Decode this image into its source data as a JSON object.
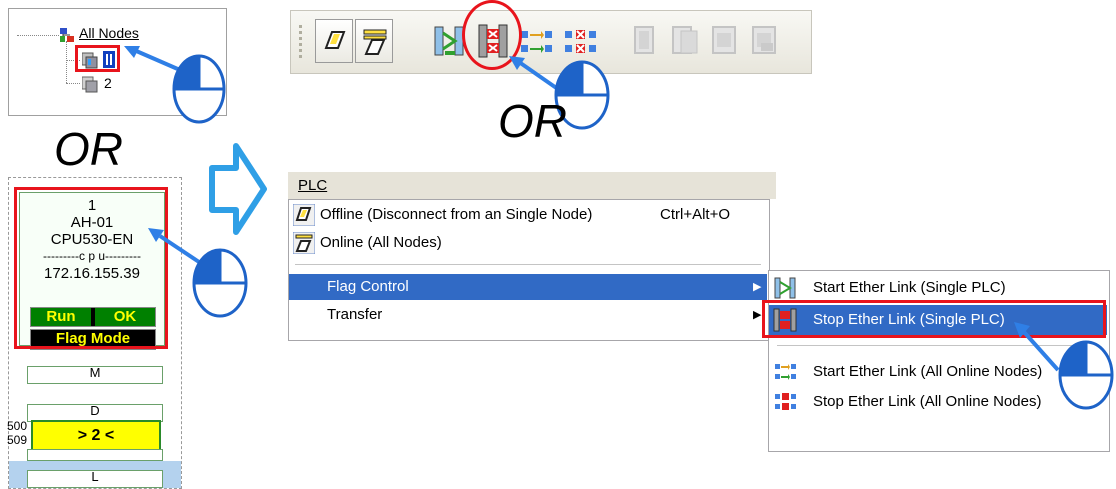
{
  "tree": {
    "root_label": "All Nodes",
    "child2_label": "2"
  },
  "or_labels": {
    "left": "OR",
    "toolbar": "OR"
  },
  "node": {
    "line1": "1",
    "line2": "AH-01",
    "line3": "CPU530-EN",
    "line4": "---------c p u---------",
    "line5": "172.16.155.39",
    "status_run": "Run",
    "status_ok": "OK",
    "flag_mode": "Flag Mode",
    "bar_m": "M",
    "bar_d": "D",
    "link_range_start": "500",
    "link_range_end": "509",
    "link_label": "> 2 <",
    "bar_l": "L"
  },
  "menu": {
    "title": "PLC",
    "items": [
      {
        "label": "Offline (Disconnect from an Single Node)",
        "shortcut": "Ctrl+Alt+O"
      },
      {
        "label": "Online (All Nodes)",
        "shortcut": ""
      },
      {
        "label": "Flag Control",
        "shortcut": ""
      },
      {
        "label": "Transfer",
        "shortcut": ""
      }
    ]
  },
  "submenu": {
    "items": [
      {
        "label": "Start Ether Link (Single PLC)"
      },
      {
        "label": "Stop Ether Link (Single PLC)"
      },
      {
        "label": "Start Ether Link (All Online Nodes)"
      },
      {
        "label": "Stop Ether Link (All Online Nodes)"
      }
    ]
  },
  "colors": {
    "highlight_red": "#e8141c",
    "menu_selected": "#316ac5",
    "arrow_blue": "#2f7fe6",
    "callout_blue": "#1e63c8",
    "link_yellow": "#ffff00"
  },
  "icons": [
    "tree-network-icon",
    "offline-icon",
    "online-icon",
    "start-link-icon",
    "stop-link-icon",
    "start-all-icon",
    "stop-all-icon",
    "transfer-icon",
    "mouse-icon",
    "right-arrow-icon"
  ]
}
